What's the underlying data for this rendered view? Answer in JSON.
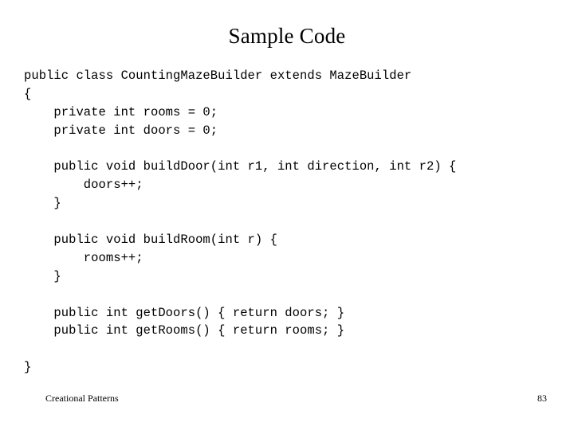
{
  "slide": {
    "title": "Sample Code",
    "background_color": "#ffffff",
    "text_color": "#000000"
  },
  "code": {
    "language": "java",
    "lines": [
      "public class CountingMazeBuilder extends MazeBuilder",
      "{",
      "    private int rooms = 0;",
      "    private int doors = 0;",
      "",
      "    public void buildDoor(int r1, int direction, int r2) {",
      "        doors++;",
      "    }",
      "",
      "    public void buildRoom(int r) {",
      "        rooms++;",
      "    }",
      "",
      "    public int getDoors() { return doors; }",
      "    public int getRooms() { return rooms; }",
      "",
      "}"
    ]
  },
  "footer": {
    "label": "Creational Patterns",
    "page_number": "83"
  }
}
